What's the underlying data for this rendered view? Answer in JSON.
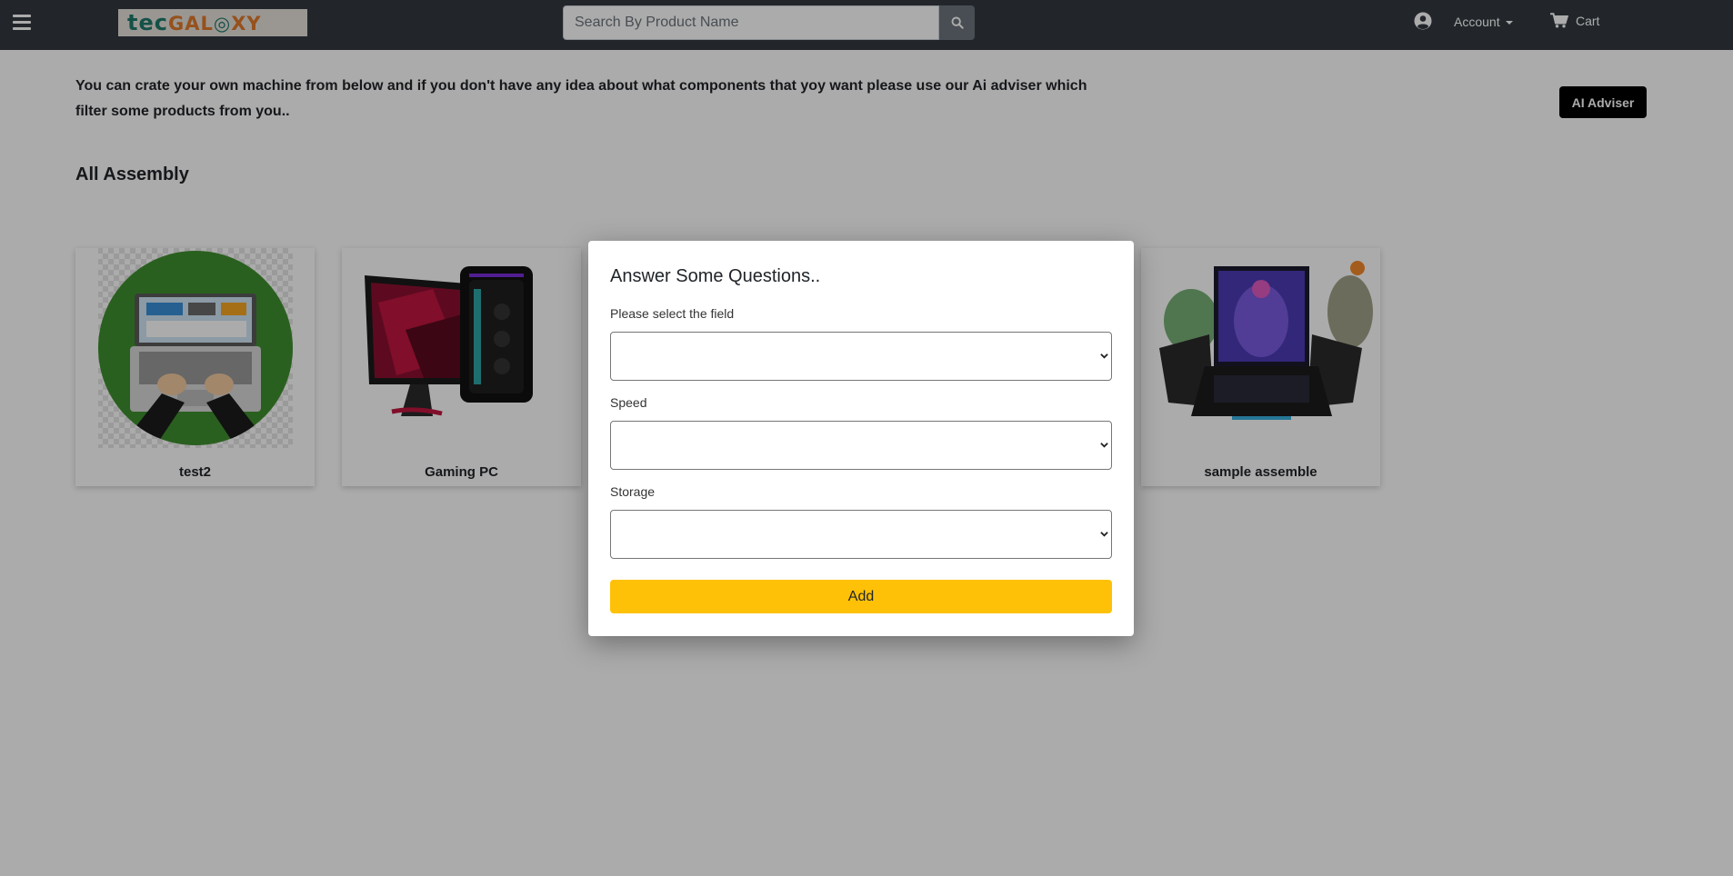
{
  "header": {
    "logo_text_part1": "tec",
    "logo_text_part2": "GAL",
    "logo_text_part3": "XY",
    "search_placeholder": "Search By Product Name",
    "account_label": "Account",
    "cart_label": "Cart"
  },
  "intro": {
    "text": "You can crate your own machine from below and if you don't have any idea about what components that yoy want please use our Ai adviser which filter some products from you..",
    "ai_button_label": "AI Adviser"
  },
  "section": {
    "title": "All Assembly"
  },
  "cards": [
    {
      "name": "test2"
    },
    {
      "name": "Gaming PC"
    },
    {
      "name": "sample assemble"
    }
  ],
  "modal": {
    "title": "Answer Some Questions..",
    "fields": [
      {
        "label": "Please select the field",
        "value": ""
      },
      {
        "label": "Speed",
        "value": ""
      },
      {
        "label": "Storage",
        "value": ""
      }
    ],
    "submit_label": "Add"
  },
  "colors": {
    "navbar": "#343a40",
    "accent": "#ffc107",
    "ai_button": "#000000"
  }
}
